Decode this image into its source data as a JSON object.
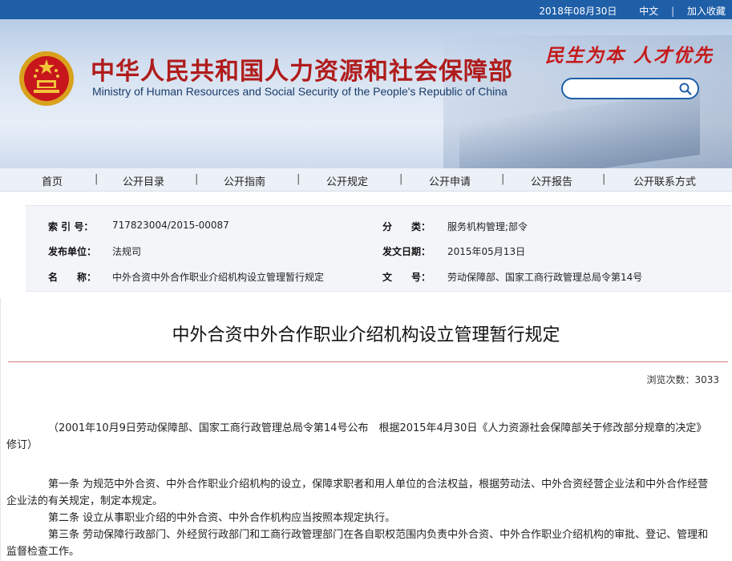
{
  "topbar": {
    "date": "2018年08月30日",
    "lang": "中文",
    "separator": "|",
    "favorite": "加入收藏"
  },
  "header": {
    "title_cn": "中华人民共和国人力资源和社会保障部",
    "title_en": "Ministry of Human Resources and Social Security of the People's Republic of China",
    "slogan": "民生为本 人才优先",
    "search": {
      "value": "",
      "placeholder": ""
    }
  },
  "nav": {
    "items": [
      "首页",
      "公开目录",
      "公开指南",
      "公开规定",
      "公开申请",
      "公开报告",
      "公开联系方式"
    ],
    "separator": "|"
  },
  "meta": {
    "index_label": "索 引 号：",
    "index_value": "717823004/2015-00087",
    "category_label": "分　　类：",
    "category_value": "服务机构管理;部令",
    "publisher_label": "发布单位：",
    "publisher_value": "法规司",
    "date_label": "发文日期：",
    "date_value": "2015年05月13日",
    "name_label": "名　　称：",
    "name_value": "中外合资中外合作职业介绍机构设立管理暂行规定",
    "docno_label": "文　　号：",
    "docno_value": "劳动保障部、国家工商行政管理总局令第14号"
  },
  "article": {
    "title": "中外合资中外合作职业介绍机构设立管理暂行规定",
    "views": "浏览次数：3033",
    "paragraphs": [
      "（2001年10月9日劳动保障部、国家工商行政管理总局令第14号公布　根据2015年4月30日《人力资源社会保障部关于修改部分规章的决定》修订）",
      "第一条 为规范中外合资、中外合作职业介绍机构的设立，保障求职者和用人单位的合法权益，根据劳动法、中外合资经营企业法和中外合作经营企业法的有关规定，制定本规定。",
      "第二条 设立从事职业介绍的中外合资、中外合作机构应当按照本规定执行。",
      "第三条 劳动保障行政部门、外经贸行政部门和工商行政管理部门在各自职权范围内负责中外合资、中外合作职业介绍机构的审批、登记、管理和监督检查工作。"
    ]
  },
  "colors": {
    "brand_blue": "#1f5fa8",
    "title_red": "#b01c1c",
    "slogan_red": "#c51a1a"
  }
}
